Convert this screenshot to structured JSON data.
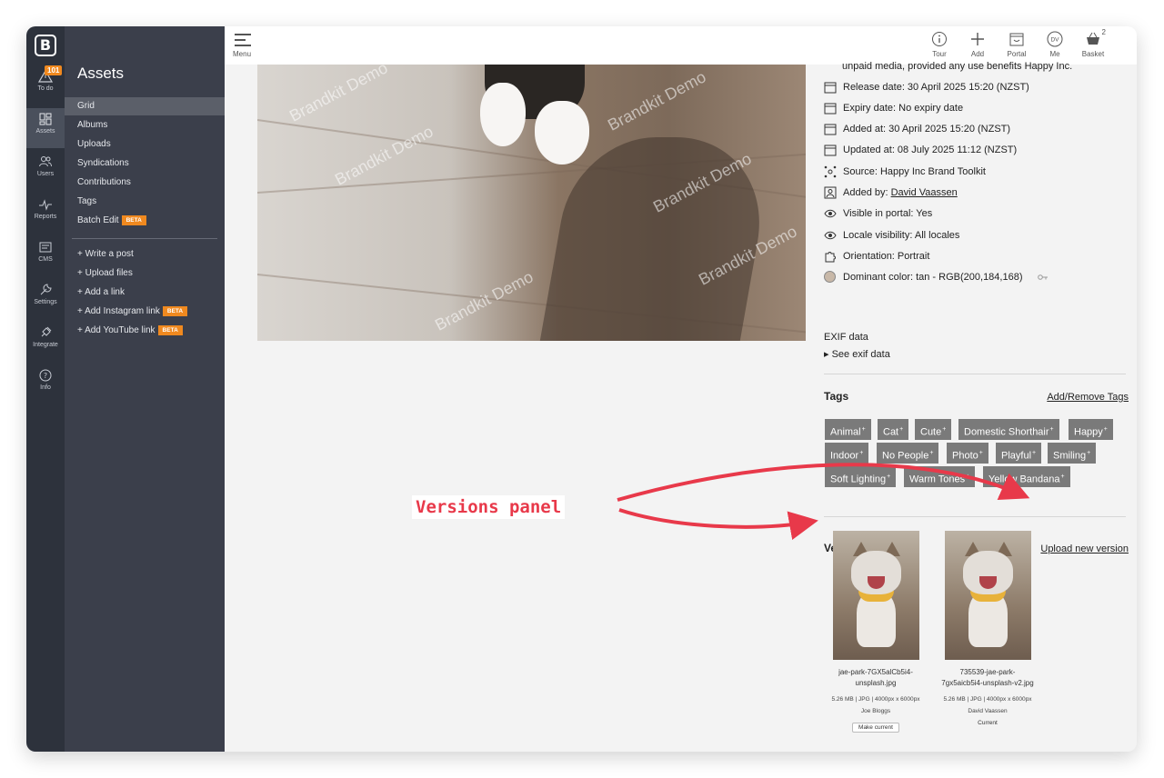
{
  "colors": {
    "rail_bg": "#2d323c",
    "sidebar_bg": "#3b3f4b",
    "accent_orange": "#f0891f",
    "tag_bg": "#7a7a7a",
    "annotation_red": "#e8394a"
  },
  "rail": {
    "logo": "B",
    "todo_count": "101",
    "items": [
      {
        "label": "To do",
        "icon": "warning-icon"
      },
      {
        "label": "Assets",
        "icon": "grid-icon"
      },
      {
        "label": "Users",
        "icon": "users-icon"
      },
      {
        "label": "Reports",
        "icon": "pulse-icon"
      },
      {
        "label": "CMS",
        "icon": "cms-icon"
      },
      {
        "label": "Settings",
        "icon": "wrench-icon"
      },
      {
        "label": "Integrate",
        "icon": "plug-icon"
      },
      {
        "label": "Info",
        "icon": "question-icon"
      }
    ]
  },
  "sidebar": {
    "title": "Assets",
    "items": [
      "Grid",
      "Albums",
      "Uploads",
      "Syndications",
      "Contributions",
      "Tags",
      "Batch Edit"
    ],
    "batch_beta": "BETA",
    "actions": [
      "+ Write a post",
      "+ Upload files",
      "+ Add a link",
      "+ Add Instagram link",
      "+ Add YouTube link"
    ],
    "action_beta": "BETA"
  },
  "topbar": {
    "menu_label": "Menu",
    "buttons": [
      {
        "label": "Tour",
        "icon": "info-circle-icon"
      },
      {
        "label": "Add",
        "icon": "plus-icon"
      },
      {
        "label": "Portal",
        "icon": "portal-icon"
      },
      {
        "label": "Me",
        "icon": "avatar-icon",
        "initials": "DV"
      },
      {
        "label": "Basket",
        "icon": "basket-icon",
        "count": "2"
      }
    ]
  },
  "hero": {
    "watermark": "Brandkit Demo"
  },
  "details": {
    "cut_text": "unpaid media, provided any use benefits Happy Inc.",
    "release_date": "Release date: 30 April 2025 15:20 (NZST)",
    "expiry_date": "Expiry date: No expiry date",
    "added_at": "Added at: 30 April 2025 15:20 (NZST)",
    "updated_at": "Updated at: 08 July 2025 11:12 (NZST)",
    "source": "Source: Happy Inc Brand Toolkit",
    "added_by_label": "Added by: ",
    "added_by_name": "David Vaassen",
    "visible_portal": "Visible in portal:  Yes",
    "locale_visibility": "Locale visibility:  All locales",
    "orientation": "Orientation:  Portrait",
    "dominant_color": "Dominant color:  tan - RGB(200,184,168)",
    "exif_title": "EXIF data",
    "exif_see": "See exif data"
  },
  "tags": {
    "title": "Tags",
    "manage_link": "Add/Remove Tags",
    "items": [
      "Animal",
      "Cat",
      "Cute",
      "Domestic Shorthair",
      "Happy",
      "Indoor",
      "No People",
      "Photo",
      "Playful",
      "Smiling",
      "Soft Lighting",
      "Warm Tones",
      "Yellow Bandana"
    ],
    "plus": "+"
  },
  "versions": {
    "title": "Versions",
    "upload_link": "Upload new version",
    "items": [
      {
        "name_line1": "jae-park-7GX5alCb5i4-",
        "name_line2": "unsplash.jpg",
        "meta": "5.26 MB | JPG | 4000px x 6000px",
        "author": "Joe Bloggs",
        "action": "Make current"
      },
      {
        "name_line1": "735539-jae-park-",
        "name_line2": "7gx5aicb5i4-unsplash-v2.jpg",
        "meta": "5.26 MB | JPG | 4000px x 6000px",
        "author": "David Vaassen",
        "status": "Current"
      }
    ]
  },
  "annotation": {
    "label": "Versions panel"
  }
}
